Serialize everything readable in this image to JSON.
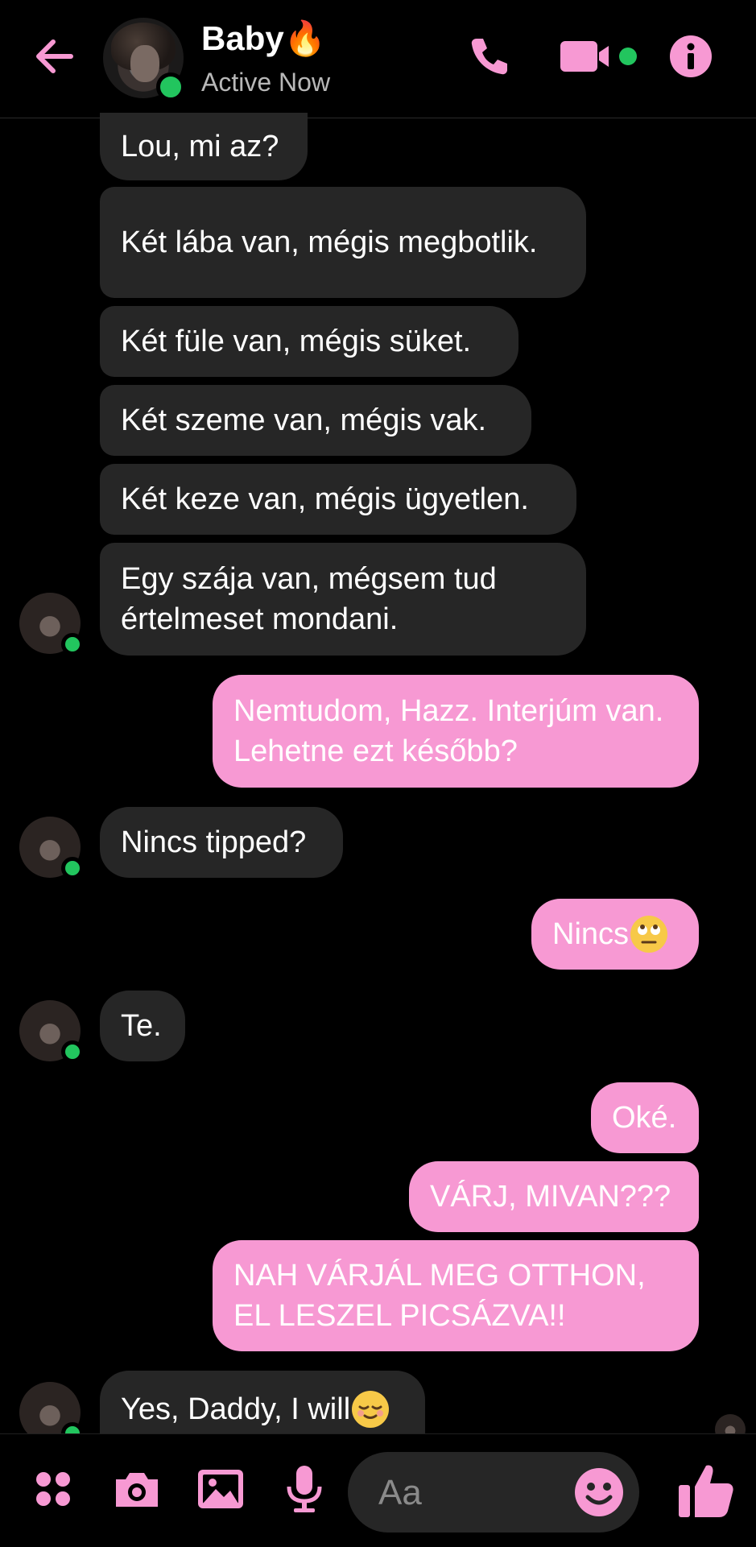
{
  "header": {
    "name": "Baby",
    "name_emoji": "🔥",
    "status": "Active Now",
    "icons": [
      "back-arrow-icon",
      "phone-icon",
      "video-camera-icon",
      "info-icon"
    ]
  },
  "colors": {
    "accent": "#f799d3",
    "incoming_bubble": "#262626",
    "online": "#22c55e",
    "background": "#000000"
  },
  "messages": [
    {
      "from": "them",
      "text": "Lou, mi az?"
    },
    {
      "from": "them",
      "text": "Két lába van, mégis megbotlik."
    },
    {
      "from": "them",
      "text": "Két füle van, mégis süket."
    },
    {
      "from": "them",
      "text": "Két szeme van, mégis vak."
    },
    {
      "from": "them",
      "text": "Két keze van, mégis ügyetlen."
    },
    {
      "from": "them",
      "text": "Egy szája van, mégsem tud értelmeset mondani."
    },
    {
      "from": "me",
      "text": "Nemtudom, Hazz. Interjúm van. Lehetne ezt később?"
    },
    {
      "from": "them",
      "text": "Nincs tipped?"
    },
    {
      "from": "me",
      "text": "Nincs",
      "emoji": "🙄"
    },
    {
      "from": "them",
      "text": "Te."
    },
    {
      "from": "me",
      "text": "Oké."
    },
    {
      "from": "me",
      "text": "VÁRJ, MIVAN???"
    },
    {
      "from": "me",
      "text": "NAH VÁRJÁL MEG OTTHON, EL LESZEL PICSÁZVA!!"
    },
    {
      "from": "them",
      "text": "Yes, Daddy, I will",
      "emoji": "😌"
    }
  ],
  "composer": {
    "placeholder": "Aa",
    "icons": [
      "apps-icon",
      "camera-icon",
      "gallery-icon",
      "microphone-icon",
      "emoji-icon",
      "thumbs-up-icon"
    ]
  }
}
